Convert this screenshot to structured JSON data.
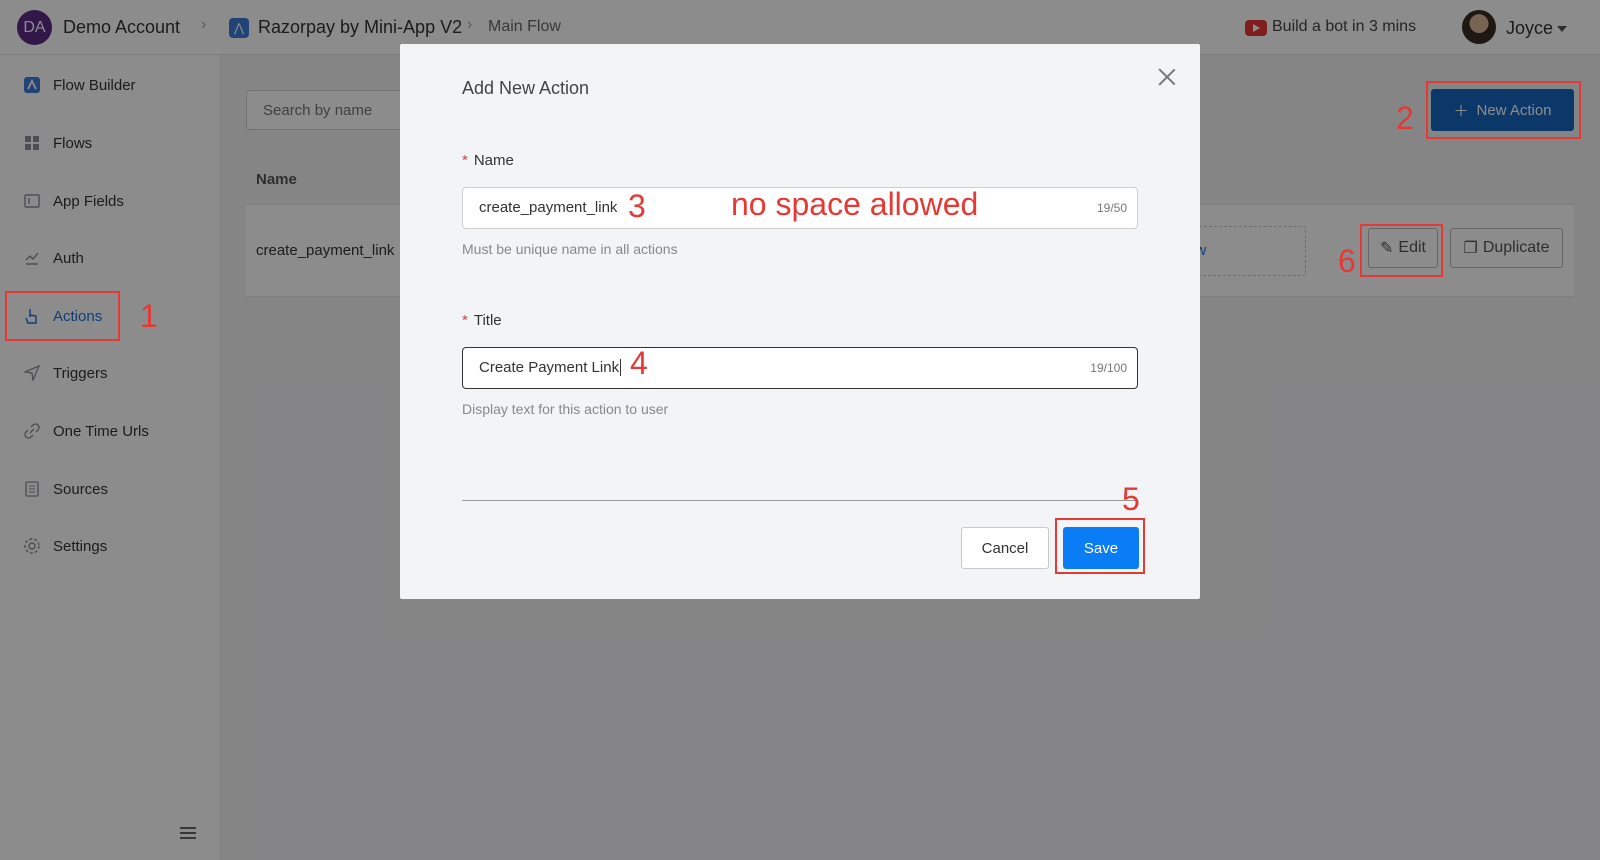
{
  "header": {
    "account_initials": "DA",
    "account_name": "Demo Account",
    "app_name": "Razorpay by Mini-App V2",
    "flow_name": "Main Flow",
    "build_link": "Build a bot in 3 mins",
    "user_name": "Joyce"
  },
  "sidebar": {
    "items": [
      {
        "label": "Flow Builder",
        "icon": "flow-builder-icon"
      },
      {
        "label": "Flows",
        "icon": "grid-icon"
      },
      {
        "label": "App Fields",
        "icon": "fields-icon"
      },
      {
        "label": "Auth",
        "icon": "auth-icon"
      },
      {
        "label": "Actions",
        "icon": "hand-pointer-icon",
        "active": true
      },
      {
        "label": "Triggers",
        "icon": "send-icon"
      },
      {
        "label": "One Time Urls",
        "icon": "link-icon"
      },
      {
        "label": "Sources",
        "icon": "document-icon"
      },
      {
        "label": "Settings",
        "icon": "gear-icon"
      }
    ]
  },
  "main": {
    "search_placeholder": "Search by name",
    "new_action_label": "New Action",
    "table": {
      "columns": [
        "Name"
      ],
      "rows": [
        {
          "name": "create_payment_link",
          "flow_fragment": "ow",
          "edit_label": "Edit",
          "duplicate_label": "Duplicate"
        }
      ]
    }
  },
  "modal": {
    "title": "Add New Action",
    "name_label": "Name",
    "name_value": "create_payment_link",
    "name_counter": "19/50",
    "name_help": "Must be unique name in all actions",
    "title_label": "Title",
    "title_value": "Create Payment Link",
    "title_counter": "19/100",
    "title_help": "Display text for this action to user",
    "cancel_label": "Cancel",
    "save_label": "Save"
  },
  "annotations": {
    "n1": "1",
    "n2": "2",
    "n3": "3",
    "n4": "4",
    "n5": "5",
    "n6": "6",
    "note": "no space allowed",
    "color": "#e53935"
  }
}
